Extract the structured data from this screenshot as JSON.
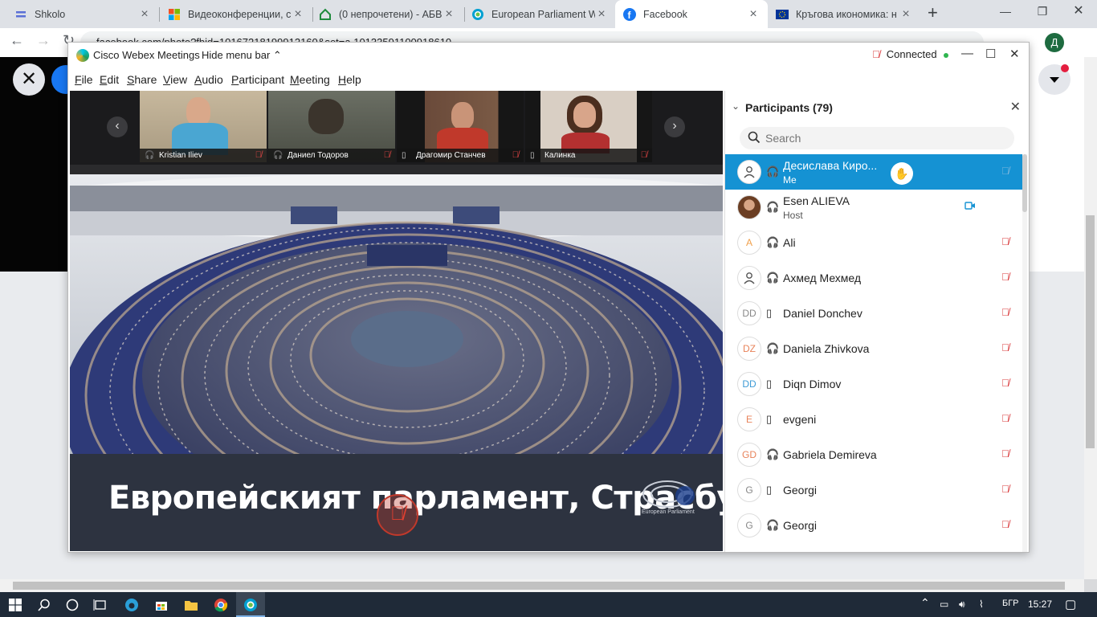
{
  "browser": {
    "tabs": [
      {
        "title": "Shkolo",
        "icon": "shkolo-icon",
        "active": false
      },
      {
        "title": "Видеоконференции, с",
        "icon": "microsoft-icon",
        "active": false
      },
      {
        "title": "(0 непрочетени) - АБВ",
        "icon": "abv-home-icon",
        "active": false
      },
      {
        "title": "European Parliament W",
        "icon": "webex-icon",
        "active": false
      },
      {
        "title": "Facebook",
        "icon": "facebook-icon",
        "active": true
      },
      {
        "title": "Кръгова икономика: н",
        "icon": "eu-flag-icon",
        "active": false
      }
    ],
    "new_tab": "+",
    "url": "facebook.com/photo?fbid=10167218199912160&set=a.10133591100918610",
    "profile_initial": "Д"
  },
  "webex": {
    "app_name": "Cisco Webex Meetings",
    "hide_menu": "Hide menu bar",
    "status": "Connected",
    "menu": [
      "File",
      "Edit",
      "Share",
      "View",
      "Audio",
      "Participant",
      "Meeting",
      "Help"
    ],
    "videos": [
      {
        "name": "Kristian Iliev",
        "device": "headset"
      },
      {
        "name": "Даниел Тодоров",
        "device": "headset"
      },
      {
        "name": "Драгомир Станчев",
        "device": "phone"
      },
      {
        "name": "Калинка",
        "device": "phone"
      }
    ],
    "shared_caption": "Европейският парламент, Страсбург",
    "ep_logo_text": "European Parliament"
  },
  "participants": {
    "title": "Participants (79)",
    "search_placeholder": "Search",
    "list": [
      {
        "initials": "",
        "avatar": "person-icon",
        "name": "Десислава Киро...",
        "role": "Me",
        "device": "headset",
        "selected": true,
        "status": "muted-dim"
      },
      {
        "initials": "",
        "avatar": "photo",
        "name": "Esen ALIEVA",
        "role": "Host",
        "device": "headset",
        "selected": false,
        "status": "video"
      },
      {
        "initials": "A",
        "avatar_color": "#f0a04b",
        "name": "Ali",
        "role": "",
        "device": "headset",
        "status": "muted"
      },
      {
        "initials": "",
        "avatar": "person-icon",
        "name": "Ахмед Мехмед",
        "role": "",
        "device": "headset",
        "status": "muted"
      },
      {
        "initials": "DD",
        "avatar_color": "#888888",
        "name": "Daniel Donchev",
        "role": "",
        "device": "phone",
        "status": "muted"
      },
      {
        "initials": "DZ",
        "avatar_color": "#e8835a",
        "name": "Daniela Zhivkova",
        "role": "",
        "device": "headset",
        "status": "muted"
      },
      {
        "initials": "DD",
        "avatar_color": "#3e9bd6",
        "name": "Diqn Dimov",
        "role": "",
        "device": "phone",
        "status": "muted"
      },
      {
        "initials": "E",
        "avatar_color": "#e8835a",
        "name": "evgeni",
        "role": "",
        "device": "phone",
        "status": "muted"
      },
      {
        "initials": "GD",
        "avatar_color": "#e8835a",
        "name": "Gabriela Demireva",
        "role": "",
        "device": "headset",
        "status": "muted"
      },
      {
        "initials": "G",
        "avatar_color": "#888888",
        "name": "Georgi",
        "role": "",
        "device": "phone",
        "status": "muted"
      },
      {
        "initials": "G",
        "avatar_color": "#888888",
        "name": "Georgi",
        "role": "",
        "device": "headset",
        "status": "muted"
      }
    ]
  },
  "taskbar": {
    "language": "БГР",
    "time": "15:27"
  },
  "colors": {
    "selected_row": "#1592d3",
    "mute_red": "#d9383a",
    "caption_band": "#2d3340",
    "taskbar": "#1f2a38"
  }
}
